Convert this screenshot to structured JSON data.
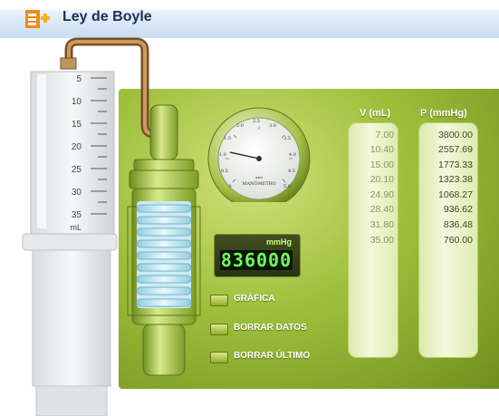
{
  "app": {
    "title": "Ley de Boyle",
    "icon": "boyle-law-app-icon"
  },
  "syringe": {
    "scale_labels": [
      "5",
      "10",
      "15",
      "20",
      "25",
      "30",
      "35"
    ],
    "unit": "mL"
  },
  "gauge": {
    "label": "MANÓMETRO",
    "unit_top": "atm",
    "scale": [
      "0",
      "0.5",
      "1.0",
      "1.5",
      "2.0",
      "2.5",
      "3.0",
      "3.5",
      "4.0",
      "4.5",
      "5.0"
    ]
  },
  "display": {
    "unit": "mmHg",
    "value": "836000"
  },
  "buttons": {
    "grafica": "GRÁFICA",
    "borrar_datos": "BORRAR DATOS",
    "borrar_ultimo": "BORRAR ÚLTIMO"
  },
  "table": {
    "headers": {
      "volume": "V (mL)",
      "pressure": "P (mmHg)"
    },
    "rows": [
      {
        "v": "7.00",
        "p": "3800.00"
      },
      {
        "v": "10.40",
        "p": "2557.69"
      },
      {
        "v": "15.00",
        "p": "1773.33"
      },
      {
        "v": "20.10",
        "p": "1323.38"
      },
      {
        "v": "24.90",
        "p": "1068.27"
      },
      {
        "v": "28.40",
        "p": "936.62"
      },
      {
        "v": "31.80",
        "p": "836.48"
      },
      {
        "v": "35.00",
        "p": "760.00"
      }
    ]
  },
  "colors": {
    "panel": "#9fbf3b",
    "title": "#1a2f55",
    "lcd": "#6cff5a"
  }
}
